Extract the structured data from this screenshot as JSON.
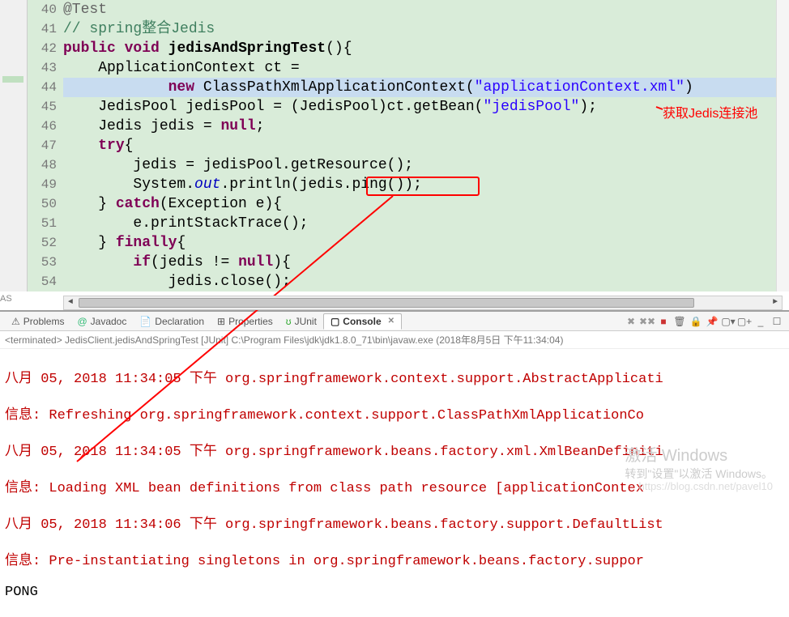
{
  "code": {
    "lines": [
      "40",
      "41",
      "42",
      "43",
      "44",
      "45",
      "46",
      "47",
      "48",
      "49",
      "50",
      "51",
      "52",
      "53",
      "54"
    ],
    "l40_anno": "@Test",
    "l41_comment": "// spring整合Jedis",
    "l42_kw1": "public",
    "l42_kw2": "void",
    "l42_method": "jedisAndSpringTest",
    "l42_paren": "(){",
    "l43_txt": "    ApplicationContext ct =",
    "l44_kw": "new",
    "l44_cls": " ClassPathXmlApplicationContext(",
    "l44_str": "\"applicationContext.xml\"",
    "l44_end": ")",
    "l45_a": "    JedisPool jedisPool = (JedisPool)ct.getBean(",
    "l45_str": "\"jedisPool\"",
    "l45_b": ");",
    "l46_a": "    Jedis jedis = ",
    "l46_kw": "null",
    "l46_b": ";",
    "l47_kw": "try",
    "l47_b": "{",
    "l48_txt": "        jedis = jedisPool.getResource();",
    "l49_a": "        System.",
    "l49_out": "out",
    "l49_b": ".println(jedis.ping());",
    "l50_a": "    } ",
    "l50_kw": "catch",
    "l50_b": "(Exception e){",
    "l51_txt": "        e.printStackTrace();",
    "l52_a": "    } ",
    "l52_kw": "finally",
    "l52_b": "{",
    "l53_a": "        ",
    "l53_kw": "if",
    "l53_b": "(jedis != ",
    "l53_kw2": "null",
    "l53_c": "){",
    "l54_txt": "            jedis.close();"
  },
  "red_annotation": "获取Jedis连接池",
  "views": {
    "problems": "Problems",
    "javadoc": "Javadoc",
    "declaration": "Declaration",
    "properties": "Properties",
    "junit": "JUnit",
    "console": "Console"
  },
  "terminated": "<terminated> JedisClient.jedisAndSpringTest [JUnit] C:\\Program Files\\jdk\\jdk1.8.0_71\\bin\\javaw.exe (2018年8月5日 下午11:34:04)",
  "console": {
    "l1": "八月 05, 2018 11:34:05 下午 org.springframework.context.support.AbstractApplicati",
    "l2": "信息: Refreshing org.springframework.context.support.ClassPathXmlApplicationCo",
    "l3": "八月 05, 2018 11:34:05 下午 org.springframework.beans.factory.xml.XmlBeanDefiniti",
    "l4": "信息: Loading XML bean definitions from class path resource [applicationContex",
    "l5": "八月 05, 2018 11:34:06 下午 org.springframework.beans.factory.support.DefaultList",
    "l6": "信息: Pre-instantiating singletons in org.springframework.beans.factory.suppor",
    "l7": "PONG"
  },
  "watermark": "激活 Windows",
  "watermark2": "转到\"设置\"以激活 Windows。",
  "watermark_url": "https://blog.csdn.net/pavel10"
}
